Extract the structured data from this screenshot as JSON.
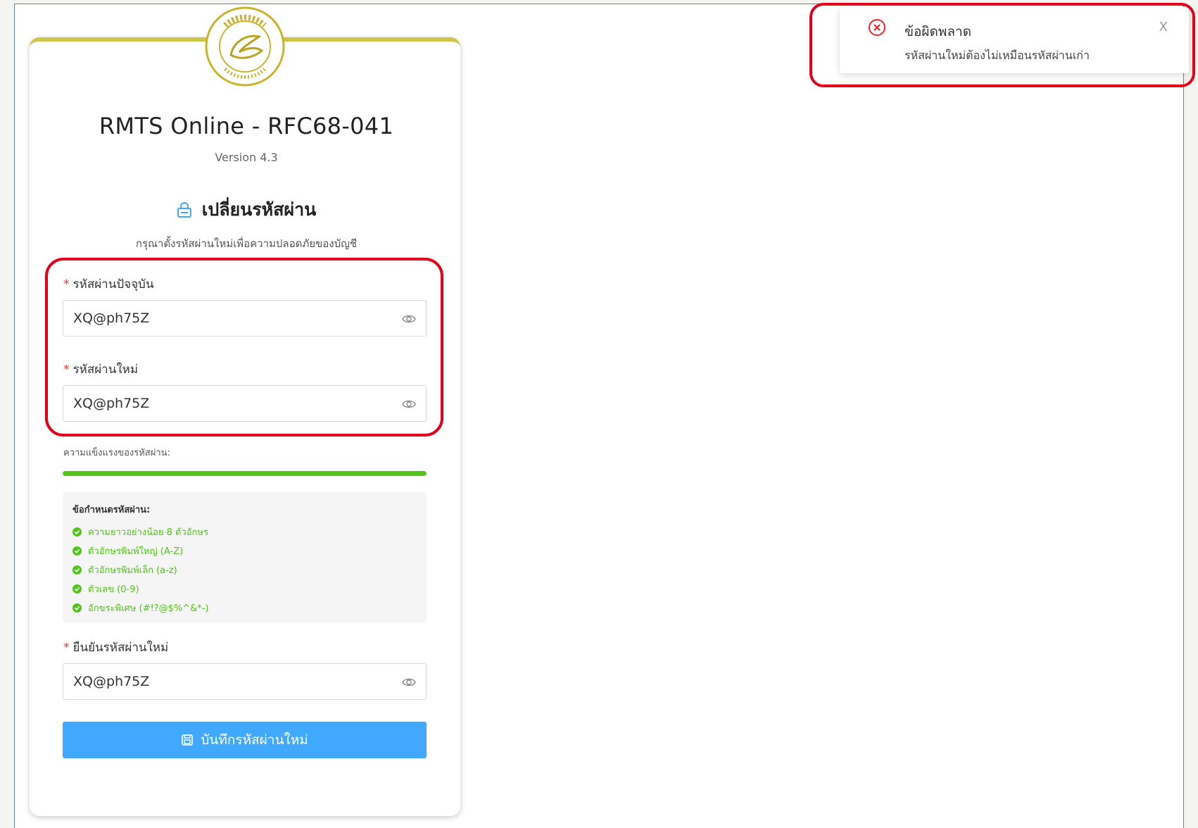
{
  "app": {
    "title": "RMTS Online - RFC68-041",
    "version": "Version 4.3"
  },
  "form": {
    "heading": "เปลี่ยนรหัสผ่าน",
    "subtitle": "กรุณาตั้งรหัสผ่านใหม่เพื่อความปลอดภัยของบัญชี",
    "required_mark": "*",
    "current_password": {
      "label": "รหัสผ่านปัจจุบัน",
      "value": "XQ@ph75Z"
    },
    "new_password": {
      "label": "รหัสผ่านใหม่",
      "value": "XQ@ph75Z"
    },
    "strength_label": "ความแข็งแรงของรหัสผ่าน:",
    "strength_level": 1.0,
    "requirements": {
      "title": "ข้อกำหนดรหัสผ่าน:",
      "items": [
        "ความยาวอย่างน้อย 8 ตัวอักษร",
        "ตัวอักษรพิมพ์ใหญ่ (A-Z)",
        "ตัวอักษรพิมพ์เล็ก (a-z)",
        "ตัวเลข (0-9)",
        "อักขระพิเศษ (#!?@$%^&*-)"
      ]
    },
    "confirm_password": {
      "label": "ยืนยันรหัสผ่านใหม่",
      "value": "XQ@ph75Z"
    },
    "save_label": "บันทึกรหัสผ่านใหม่"
  },
  "toast": {
    "title": "ข้อผิดพลาด",
    "message": "รหัสผ่านใหม่ต้องไม่เหมือนรหัสผ่านเก่า",
    "close": "X"
  },
  "colors": {
    "accent": "#40a9ff",
    "success": "#52c41a",
    "error": "#f5222d",
    "brand_gold": "#c9b42c",
    "annotation": "#e3001b"
  }
}
